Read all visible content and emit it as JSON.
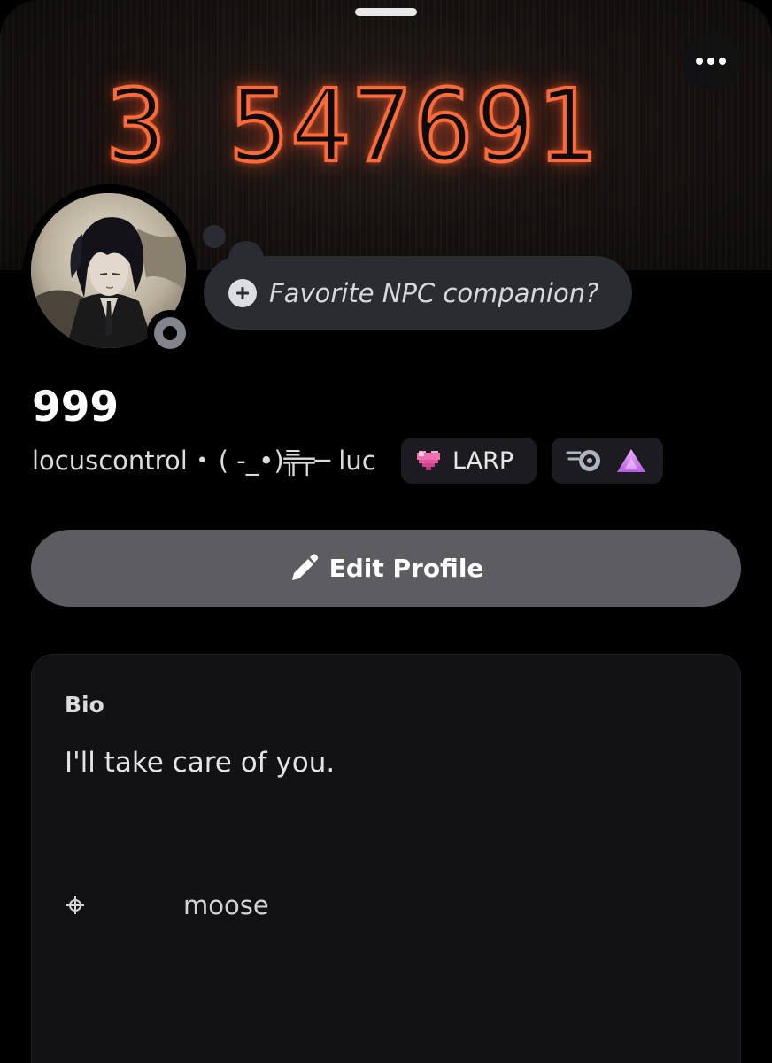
{
  "banner": {
    "number": "3 547691",
    "glow_color": "#ff6a3a"
  },
  "header": {
    "grabber_icon": "drag-handle",
    "more_icon": "ellipsis-horizontal"
  },
  "status_bubble": {
    "icon": "plus-circle",
    "text": "Favorite NPC companion?"
  },
  "profile": {
    "display_name": "999",
    "username": "locuscontrol",
    "separator": "•",
    "pronouns": "( -_•)╦̵̵̿╤─ luc",
    "status": "offline",
    "badges": [
      {
        "icon": "pixel-heart",
        "label": "LARP"
      },
      {
        "icons": [
          "turbo-gauge",
          "purple-triangle"
        ]
      }
    ]
  },
  "edit_button": {
    "label": "Edit Profile",
    "icon": "pencil"
  },
  "bio": {
    "heading": "Bio",
    "text": "I'll take care of you.",
    "extra_icon": "crosshair",
    "extra_text": "moose"
  }
}
